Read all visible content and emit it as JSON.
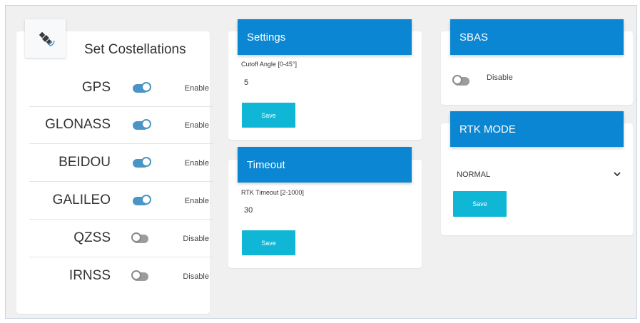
{
  "constellations": {
    "title": "Set Costellations",
    "icon": "satellite-icon",
    "items": [
      {
        "name": "GPS",
        "enabled": true,
        "state": "Enable"
      },
      {
        "name": "GLONASS",
        "enabled": true,
        "state": "Enable"
      },
      {
        "name": "BEIDOU",
        "enabled": true,
        "state": "Enable"
      },
      {
        "name": "GALILEO",
        "enabled": true,
        "state": "Enable"
      },
      {
        "name": "QZSS",
        "enabled": false,
        "state": "Disable"
      },
      {
        "name": "IRNSS",
        "enabled": false,
        "state": "Disable"
      }
    ]
  },
  "settings": {
    "title": "Settings",
    "field_label": "Cutoff Angle [0-45°]",
    "field_value": "5",
    "save_label": "Save"
  },
  "timeout": {
    "title": "Timeout",
    "field_label": "RTK Timeout [2-1000]",
    "field_value": "30",
    "save_label": "Save"
  },
  "sbas": {
    "title": "SBAS",
    "enabled": false,
    "state": "Disable"
  },
  "rtk_mode": {
    "title": "RTK MODE",
    "selected": "NORMAL",
    "save_label": "Save"
  },
  "colors": {
    "header": "#0a86d2",
    "button": "#0fb6d6",
    "toggle_on": "#4a95c6",
    "toggle_off": "#9c9c9c"
  }
}
